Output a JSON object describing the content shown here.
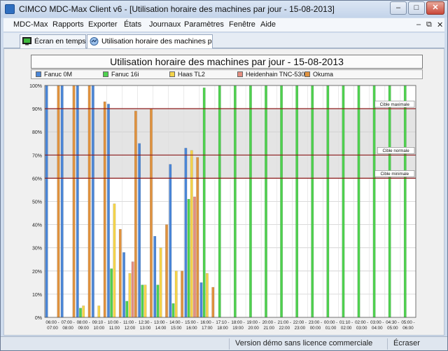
{
  "window": {
    "title": "CIMCO MDC-Max Client v6 - [Utilisation horaire des machines par jour - 15-08-2013]",
    "minimize": "–",
    "maximize": "□",
    "close": "✕"
  },
  "menu": {
    "items": [
      "MDC-Max",
      "Rapports",
      "Exporter",
      "États",
      "Journaux",
      "Paramètres",
      "Fenêtre",
      "Aide"
    ],
    "mdi_minimize": "–",
    "mdi_restore": "⧉",
    "mdi_close": "✕"
  },
  "tabs": [
    {
      "label": "Écran en temps réel",
      "icon": "monitor-icon"
    },
    {
      "label": "Utilisation horaire des machines par jour...",
      "icon": "report-icon"
    }
  ],
  "colors": {
    "Fanuc 0M": "#4a86d8",
    "Fanuc 16i": "#4fd14f",
    "Haas TL2": "#f5d44a",
    "Heidenhain TNC-530": "#e58e80",
    "Okuma": "#e0923e",
    "target_line": "#8b1a1a",
    "band": "#e4e4e4"
  },
  "status": {
    "message": "Version démo sans licence commerciale",
    "mode": "Écraser"
  },
  "chart_data": {
    "type": "bar",
    "title": "Utilisation horaire des machines par jour - 15-08-2013",
    "xlabel": "",
    "ylabel": "",
    "ylim": [
      0,
      100
    ],
    "yticks": [
      "0%",
      "10%",
      "20%",
      "30%",
      "40%",
      "50%",
      "60%",
      "70%",
      "80%",
      "90%",
      "100%"
    ],
    "grid": true,
    "legend_position": "top",
    "categories": [
      "06:00 - 07:00",
      "07:00 - 08:00",
      "08:00 - 09:00",
      "09:10 - 10:00",
      "10:00 - 11:00",
      "11:00 - 12:00",
      "12:30 - 13:00",
      "13:00 - 14:00",
      "14:00 - 15:00",
      "15:00 - 16:00",
      "16:00 - 17:00",
      "17:10 - 18:00",
      "18:00 - 19:00",
      "19:00 - 20:00",
      "20:00 - 21:00",
      "21:00 - 22:00",
      "22:00 - 23:00",
      "23:00 - 00:00",
      "00:00 - 01:00",
      "01:10 - 02:00",
      "02:00 - 03:00",
      "03:00 - 04:00",
      "04:30 - 05:00",
      "05:00 - 06:00"
    ],
    "series": [
      {
        "name": "Fanuc 0M",
        "values": [
          100,
          100,
          100,
          100,
          92,
          28,
          75,
          35,
          66,
          73,
          15,
          0,
          0,
          0,
          0,
          0,
          0,
          0,
          0,
          0,
          0,
          0,
          0,
          0
        ]
      },
      {
        "name": "Fanuc 16i",
        "values": [
          0,
          0,
          4,
          0,
          21,
          7,
          14,
          14,
          6,
          51,
          99,
          100,
          100,
          100,
          100,
          100,
          100,
          100,
          100,
          100,
          100,
          100,
          100,
          100
        ]
      },
      {
        "name": "Haas TL2",
        "values": [
          0,
          0,
          5,
          5,
          49,
          19,
          14,
          30,
          20,
          72,
          19,
          0,
          0,
          0,
          0,
          0,
          0,
          0,
          0,
          0,
          0,
          0,
          0,
          0
        ]
      },
      {
        "name": "Heidenhain TNC-530",
        "values": [
          0,
          0,
          0,
          0,
          0,
          24,
          0,
          0,
          0,
          52,
          0,
          0,
          0,
          0,
          0,
          0,
          0,
          0,
          0,
          0,
          0,
          0,
          0,
          0
        ]
      },
      {
        "name": "Okuma",
        "values": [
          100,
          100,
          100,
          93,
          38,
          89,
          90,
          40,
          20,
          69,
          13,
          0,
          0,
          0,
          0,
          0,
          0,
          0,
          0,
          0,
          0,
          0,
          0,
          0
        ]
      }
    ],
    "targets": [
      {
        "label": "Cible maximale",
        "value": 90
      },
      {
        "label": "Cible normale",
        "value": 70
      },
      {
        "label": "Cible minimale",
        "value": 60
      }
    ]
  }
}
